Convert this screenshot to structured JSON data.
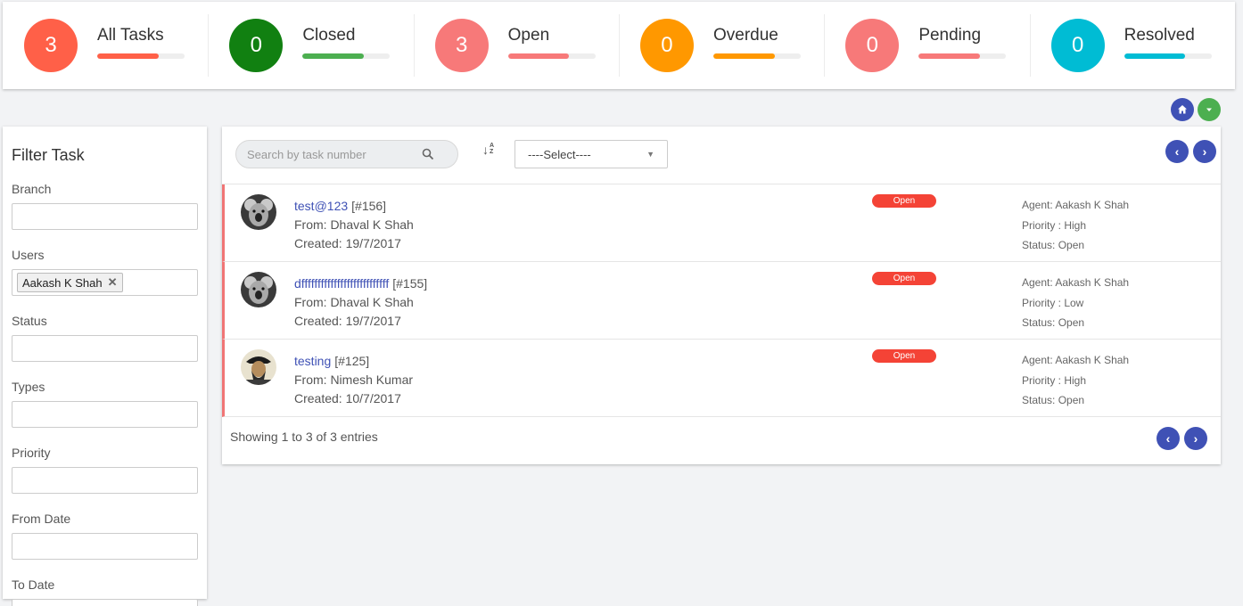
{
  "stats": [
    {
      "count": "3",
      "label": "All Tasks",
      "color": "#ff6048",
      "bar": "#ff6048"
    },
    {
      "count": "0",
      "label": "Closed",
      "color": "#118011",
      "bar": "#4caf50"
    },
    {
      "count": "3",
      "label": "Open",
      "color": "#f77979",
      "bar": "#f77979"
    },
    {
      "count": "0",
      "label": "Overdue",
      "color": "#ff9800",
      "bar": "#ff9800"
    },
    {
      "count": "0",
      "label": "Pending",
      "color": "#f77979",
      "bar": "#f77979"
    },
    {
      "count": "0",
      "label": "Resolved",
      "color": "#00bcd4",
      "bar": "#00bcd4"
    }
  ],
  "header_buttons": {
    "home_icon": "home-icon",
    "more_icon": "chevron-down-icon"
  },
  "filter": {
    "title": "Filter Task",
    "branch_label": "Branch",
    "users_label": "Users",
    "users_tag": "Aakash K Shah",
    "status_label": "Status",
    "types_label": "Types",
    "priority_label": "Priority",
    "from_date_label": "From Date",
    "to_date_label": "To Date"
  },
  "toolbar": {
    "search_placeholder": "Search by task number",
    "sort_icon": "↓",
    "sort_az": "A Z",
    "select_value": "----Select----"
  },
  "tasks": [
    {
      "title": "test@123",
      "number": "[#156]",
      "from": "From: Dhaval K Shah",
      "created": "Created: 19/7/2017",
      "status_badge": "Open",
      "agent": "Agent: Aakash K Shah",
      "priority": "Priority : High",
      "status": "Status: Open"
    },
    {
      "title": "dfffffffffffffffffffffffffff",
      "number": "[#155]",
      "from": "From: Dhaval K Shah",
      "created": "Created: 19/7/2017",
      "status_badge": "Open",
      "agent": "Agent: Aakash K Shah",
      "priority": "Priority : Low",
      "status": "Status: Open"
    },
    {
      "title": "testing",
      "number": "[#125]",
      "from": "From: Nimesh Kumar",
      "created": "Created: 10/7/2017",
      "status_badge": "Open",
      "agent": "Agent: Aakash K Shah",
      "priority": "Priority : High",
      "status": "Status: Open"
    }
  ],
  "footer": {
    "text": "Showing 1 to 3 of 3 entries"
  },
  "colors": {
    "accent": "#3f51b5",
    "open_badge": "#f44336",
    "row_border": "#f07575"
  }
}
